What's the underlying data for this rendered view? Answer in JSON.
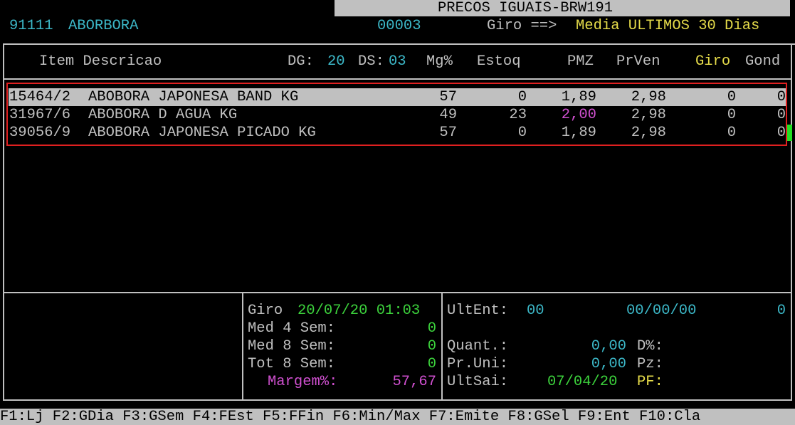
{
  "title": "PRECOS IGUAIS-BRW191",
  "header": {
    "product_code": "91111",
    "product_name": "ABORBORA",
    "count": "00003",
    "giro_label": "Giro ==>",
    "giro_value": "Media ULTIMOS 30 Dias"
  },
  "columns": {
    "item_desc": "Item Descricao",
    "dg_label": "DG:",
    "dg_value": "20",
    "ds_label": "DS:",
    "ds_value": "03",
    "mg": "Mg%",
    "estoq": "Estoq",
    "pmz": "PMZ",
    "prven": "PrVen",
    "giro": "Giro",
    "gond": "Gond"
  },
  "rows": [
    {
      "code": "15464/2",
      "desc": "ABOBORA JAPONESA BAND KG",
      "mg": "57",
      "estoq": "0",
      "pmz": "1,89",
      "prven": "2,98",
      "giro": "0",
      "gond": "0"
    },
    {
      "code": "31967/6",
      "desc": "ABOBORA D AGUA KG",
      "mg": "49",
      "estoq": "23",
      "pmz": "2,00",
      "prven": "2,98",
      "giro": "0",
      "gond": "0"
    },
    {
      "code": "39056/9",
      "desc": "ABOBORA JAPONESA PICADO KG",
      "mg": "57",
      "estoq": "0",
      "pmz": "1,89",
      "prven": "2,98",
      "giro": "0",
      "gond": "0"
    }
  ],
  "stats": {
    "giro_label": "Giro",
    "giro_datetime": "20/07/20 01:03",
    "med4_label": "Med 4 Sem:",
    "med4_value": "0",
    "med8_label": "Med 8 Sem:",
    "med8_value": "0",
    "tot8_label": "Tot 8 Sem:",
    "tot8_value": "0",
    "margem_label": "Margem%:",
    "margem_value": "57,67"
  },
  "entries": {
    "ultent_label": "UltEnt:",
    "ultent_value": "00",
    "ultent_date": "00/00/00",
    "ultent_qty": "0",
    "quant_label": "Quant.:",
    "quant_value": "0,00",
    "dpct_label": "D%:",
    "pruni_label": "Pr.Uni:",
    "pruni_value": "0,00",
    "pz_label": "Pz:",
    "ultsai_label": "UltSai:",
    "ultsai_date": "07/04/20",
    "pf_label": "PF:"
  },
  "function_keys": "F1:Lj F2:GDia F3:GSem F4:FEst F5:FFin F6:Min/Max F7:Emite F8:GSel F9:Ent F10:Cla",
  "colors": {
    "background": "#000000",
    "text": "#c0c0c0",
    "cyan": "#3cb8c8",
    "yellow": "#e6dc4a",
    "green": "#3cd23c",
    "magenta": "#d050d0",
    "highlight": "#e02020"
  }
}
